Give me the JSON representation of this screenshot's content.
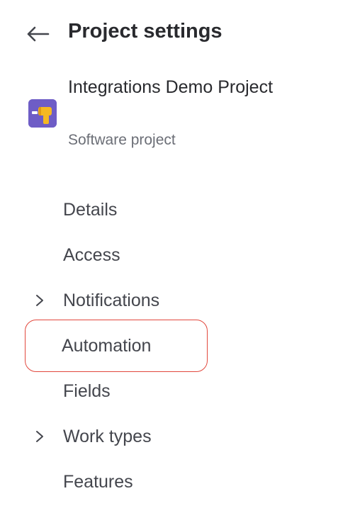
{
  "header": {
    "title": "Project settings",
    "back_icon": "arrow-left-icon"
  },
  "project": {
    "name": "Integrations Demo Project",
    "type": "Software project",
    "avatar_icon": "drill-icon",
    "avatar_color": "#6e5dc6",
    "avatar_accent": "#f5b822"
  },
  "nav": {
    "items": [
      {
        "label": "Details",
        "expandable": false
      },
      {
        "label": "Access",
        "expandable": false
      },
      {
        "label": "Notifications",
        "expandable": true
      },
      {
        "label": "Automation",
        "expandable": false,
        "selected": true
      },
      {
        "label": "Fields",
        "expandable": false
      },
      {
        "label": "Work types",
        "expandable": true
      },
      {
        "label": "Features",
        "expandable": false
      }
    ]
  },
  "colors": {
    "text_primary": "#292a2e",
    "text_secondary": "#6b6e76",
    "highlight_border": "#e2483d"
  }
}
